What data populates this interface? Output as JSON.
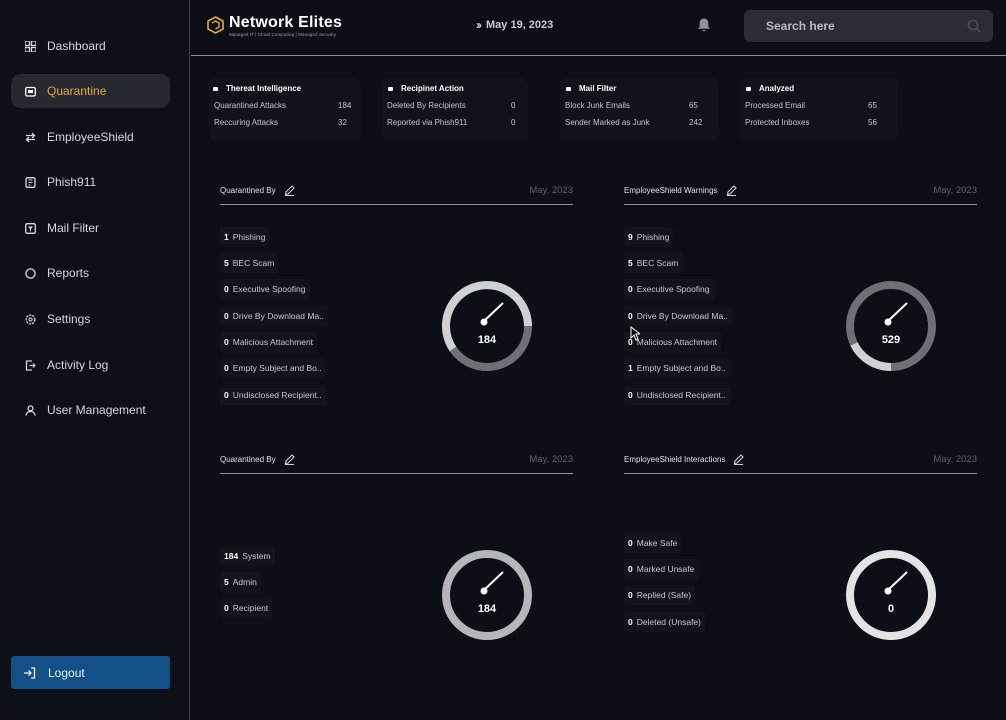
{
  "sidebar": {
    "items": [
      {
        "label": "Dashboard",
        "icon": "dashboard-icon"
      },
      {
        "label": "Quarantine",
        "icon": "quarantine-icon",
        "active": true
      },
      {
        "label": "EmployeeShield",
        "icon": "exchange-icon"
      },
      {
        "label": "Phish911",
        "icon": "phish-icon"
      },
      {
        "label": "Mail Filter",
        "icon": "mail-filter-icon"
      },
      {
        "label": "Reports",
        "icon": "reports-icon"
      },
      {
        "label": "Settings",
        "icon": "settings-icon"
      },
      {
        "label": "Activity Log",
        "icon": "activity-log-icon"
      },
      {
        "label": "User Management",
        "icon": "user-icon"
      }
    ],
    "logout_label": "Logout"
  },
  "header": {
    "brand": "Network Elites",
    "tagline": "Managed IT | Cloud Computing | Managed Security",
    "date": "May 19, 2023",
    "search_placeholder": "Search here"
  },
  "stats": [
    {
      "title": "Thereat Intelligence",
      "rows": [
        {
          "label": "Quarantined Attacks",
          "value": "184"
        },
        {
          "label": "Reccuring Attacks",
          "value": "32"
        }
      ]
    },
    {
      "title": "Recipinet Action",
      "rows": [
        {
          "label": "Deleted By Recipients",
          "value": "0"
        },
        {
          "label": "Reported via Phish911",
          "value": "0"
        }
      ]
    },
    {
      "title": "Mail Filter",
      "rows": [
        {
          "label": "Block Junk Emails",
          "value": "65"
        },
        {
          "label": "Sender Marked as Junk",
          "value": "242"
        }
      ]
    },
    {
      "title": "Analyzed",
      "rows": [
        {
          "label": "Processed Email",
          "value": "65"
        },
        {
          "label": "Protected Inboxes",
          "value": "56"
        }
      ]
    }
  ],
  "panels": [
    {
      "title": "Quarantined By",
      "date": "May, 2023",
      "total": "184",
      "items": [
        {
          "count": "1",
          "label": "Phishing"
        },
        {
          "count": "5",
          "label": "BEC Scam"
        },
        {
          "count": "0",
          "label": "Executive Spoofing"
        },
        {
          "count": "0",
          "label": "Drive By Download Ma.."
        },
        {
          "count": "0",
          "label": "Malicious Attachment"
        },
        {
          "count": "0",
          "label": "Empty Subject and Bo.."
        },
        {
          "count": "0",
          "label": "Undisclosed Recipient.."
        }
      ]
    },
    {
      "title": "EmployeeShield Warnings",
      "date": "May, 2023",
      "total": "529",
      "items": [
        {
          "count": "9",
          "label": "Phishing"
        },
        {
          "count": "5",
          "label": "BEC Scam"
        },
        {
          "count": "0",
          "label": "Executive Spoofing"
        },
        {
          "count": "0",
          "label": "Drive By Download Ma.."
        },
        {
          "count": "0",
          "label": "Malicious Attachment"
        },
        {
          "count": "1",
          "label": "Empty Subject and Bo.."
        },
        {
          "count": "0",
          "label": "Undisclosed Recipient.."
        }
      ]
    },
    {
      "title": "Quarantined By",
      "date": "May, 2023",
      "total": "184",
      "items": [
        {
          "count": "184",
          "label": "System"
        },
        {
          "count": "5",
          "label": "Admin"
        },
        {
          "count": "0",
          "label": "Recipient"
        }
      ]
    },
    {
      "title": "EmployeeShield Interactions",
      "date": "May, 2023",
      "total": "0",
      "items": [
        {
          "count": "0",
          "label": "Make Safe"
        },
        {
          "count": "0",
          "label": "Marked Unsafe"
        },
        {
          "count": "0",
          "label": "Replied (Safe)"
        },
        {
          "count": "0",
          "label": "Deleted (Unsafe)"
        }
      ]
    }
  ],
  "colors": {
    "accent": "#e7a93f",
    "logout": "#114f86",
    "gauge_light": "#cfd1d4",
    "gauge_dark": "#6d7075"
  }
}
